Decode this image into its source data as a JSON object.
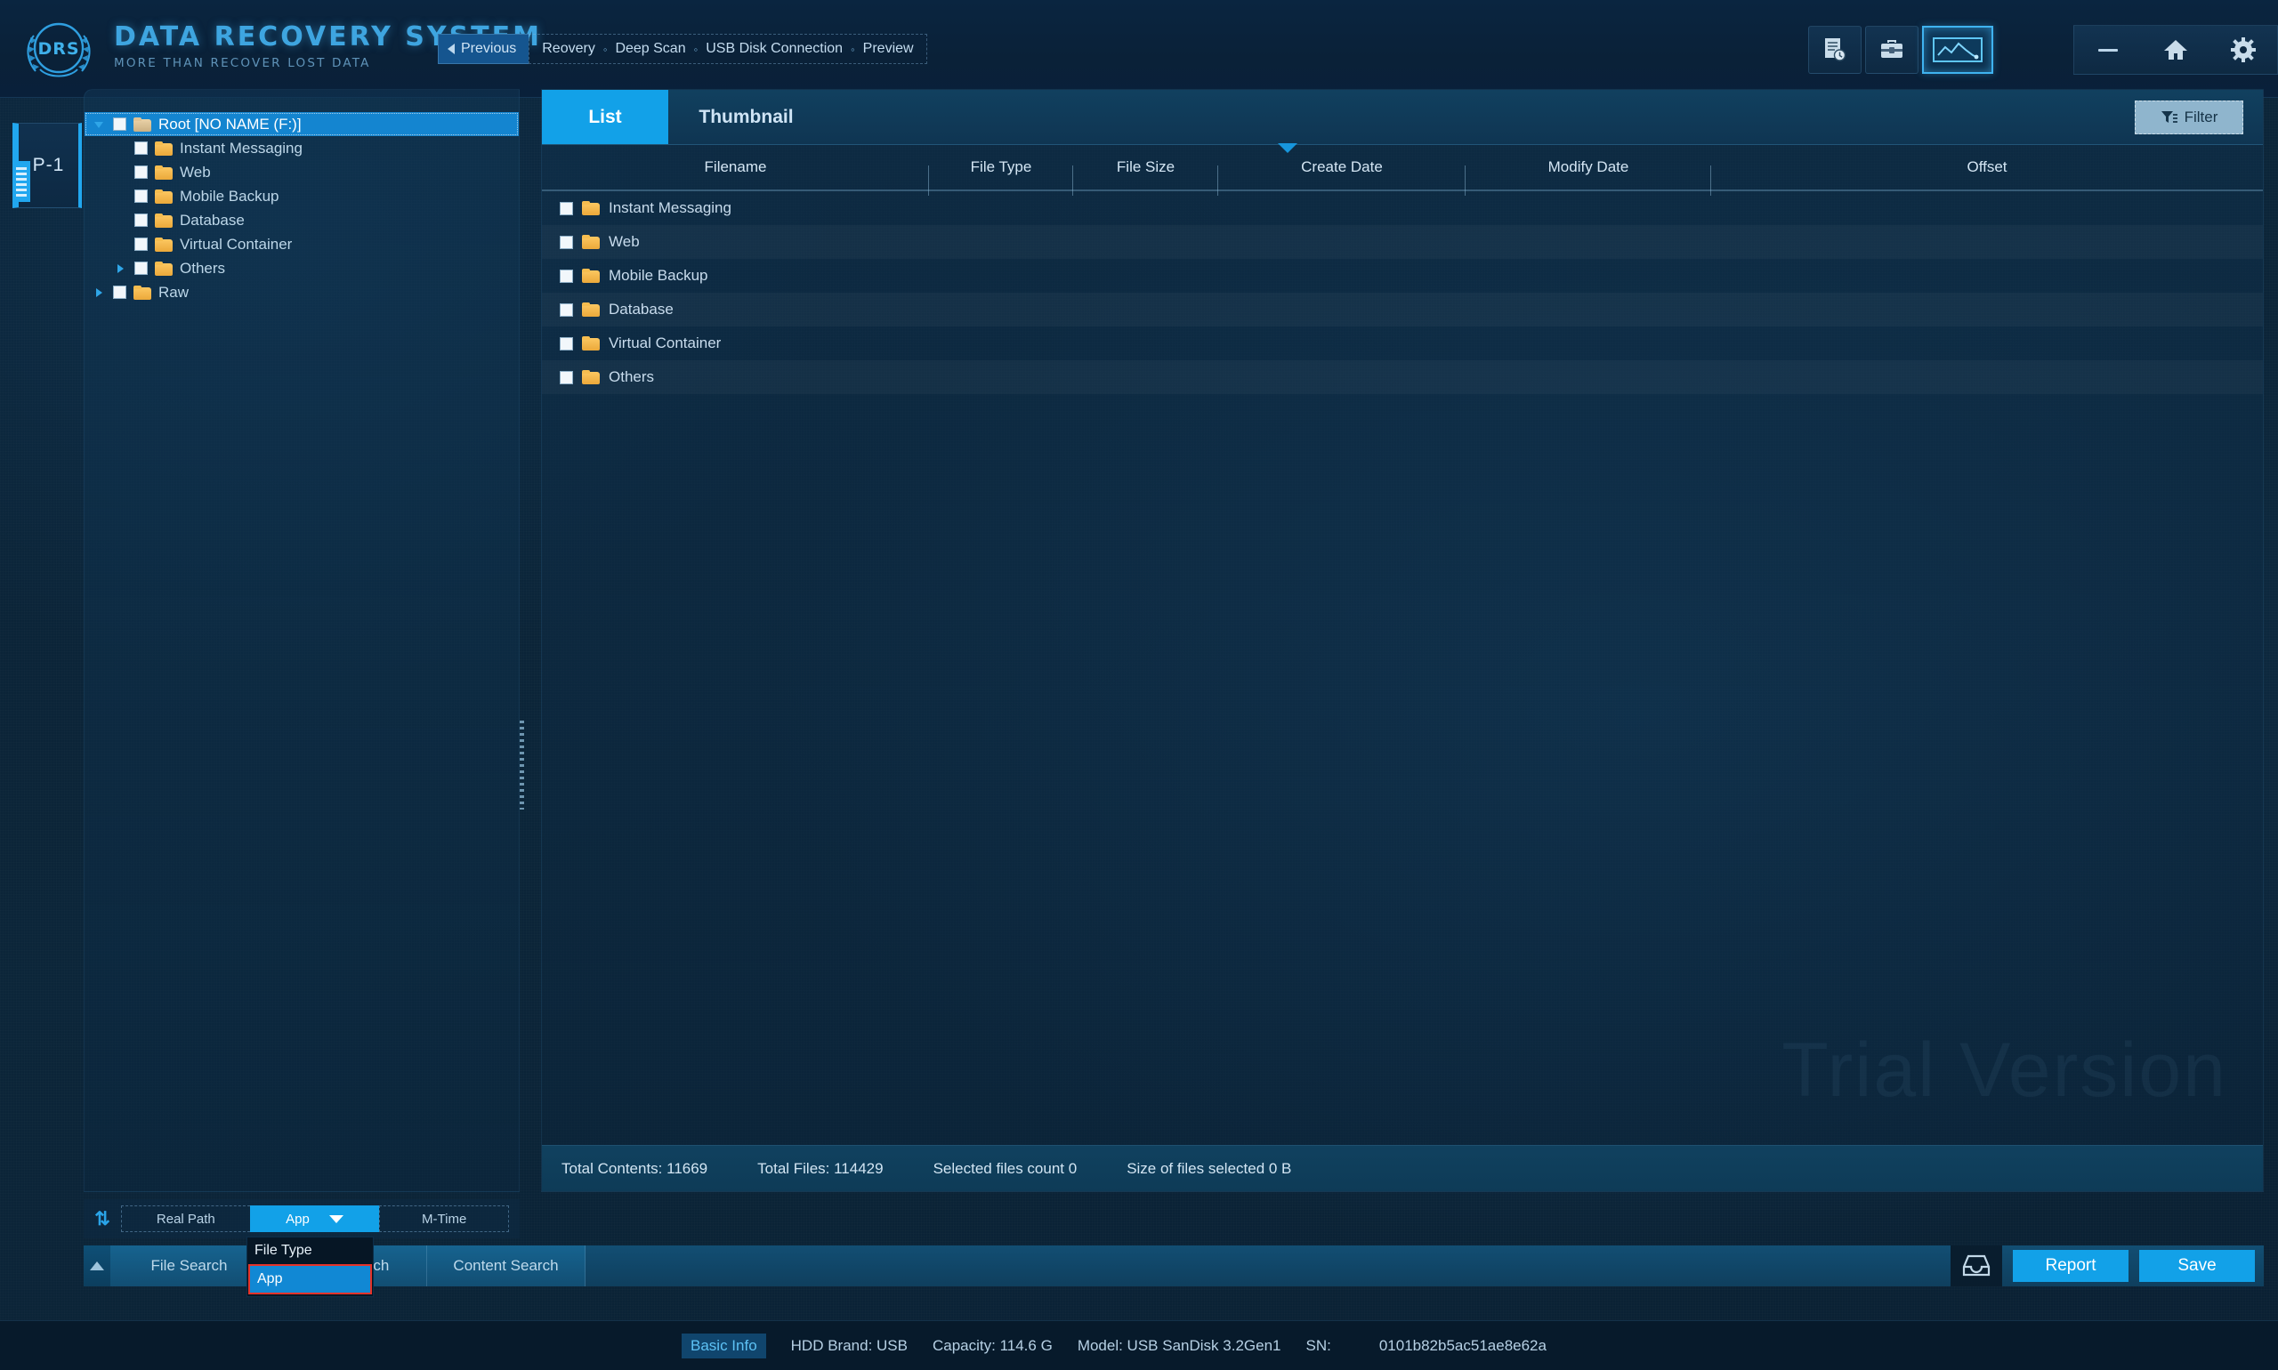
{
  "brand": {
    "title": "DATA RECOVERY SYSTEM",
    "subtitle": "MORE THAN RECOVER LOST DATA",
    "logo_text": "DRS"
  },
  "breadcrumb": {
    "previous_label": "Previous",
    "steps": [
      "Reovery",
      "Deep Scan",
      "USB Disk Connection",
      "Preview"
    ],
    "separator": "○"
  },
  "titlebar_icons": [
    {
      "name": "log-report-icon",
      "glyph": "Ὕ2"
    },
    {
      "name": "toolbox-icon",
      "glyph": "toolbox"
    },
    {
      "name": "disk-monitor-icon",
      "glyph": "chart",
      "active": true
    }
  ],
  "window_controls": [
    {
      "name": "minimize-button",
      "label": "—"
    },
    {
      "name": "home-button",
      "label": "home"
    },
    {
      "name": "settings-button",
      "label": "gear"
    }
  ],
  "partition_tab": {
    "label": "P-1"
  },
  "tree": {
    "nodes": [
      {
        "label": "Root [NO NAME    (F:)]",
        "indent": 0,
        "arrow": "down",
        "selected": true,
        "checked": false
      },
      {
        "label": "Instant Messaging",
        "indent": 1,
        "arrow": "none",
        "selected": false,
        "checked": false
      },
      {
        "label": "Web",
        "indent": 1,
        "arrow": "none",
        "selected": false,
        "checked": false
      },
      {
        "label": "Mobile Backup",
        "indent": 1,
        "arrow": "none",
        "selected": false,
        "checked": false
      },
      {
        "label": "Database",
        "indent": 1,
        "arrow": "none",
        "selected": false,
        "checked": false
      },
      {
        "label": "Virtual Container",
        "indent": 1,
        "arrow": "none",
        "selected": false,
        "checked": false
      },
      {
        "label": "Others",
        "indent": 1,
        "arrow": "right",
        "selected": false,
        "checked": false
      },
      {
        "label": "Raw",
        "indent": 0,
        "arrow": "right",
        "selected": false,
        "checked": false
      }
    ]
  },
  "main": {
    "tabs": [
      {
        "label": "List",
        "active": true
      },
      {
        "label": "Thumbnail",
        "active": false
      }
    ],
    "filter_label": "Filter",
    "columns": [
      "Filename",
      "File Type",
      "File Size",
      "Create Date",
      "Modify Date",
      "Offset"
    ],
    "rows": [
      {
        "filename": "Instant Messaging",
        "file_type": "",
        "file_size": "",
        "create_date": "",
        "modify_date": "",
        "offset": ""
      },
      {
        "filename": "Web",
        "file_type": "",
        "file_size": "",
        "create_date": "",
        "modify_date": "",
        "offset": ""
      },
      {
        "filename": "Mobile Backup",
        "file_type": "",
        "file_size": "",
        "create_date": "",
        "modify_date": "",
        "offset": ""
      },
      {
        "filename": "Database",
        "file_type": "",
        "file_size": "",
        "create_date": "",
        "modify_date": "",
        "offset": ""
      },
      {
        "filename": "Virtual Container",
        "file_type": "",
        "file_size": "",
        "create_date": "",
        "modify_date": "",
        "offset": ""
      },
      {
        "filename": "Others",
        "file_type": "",
        "file_size": "",
        "create_date": "",
        "modify_date": "",
        "offset": ""
      }
    ],
    "watermark": "Trial Version",
    "status": {
      "total_contents": "Total Contents: 11669",
      "total_files": "Total Files: 114429",
      "selected_count": "Selected files count 0",
      "selected_size": "Size of files  selected  0 B"
    }
  },
  "sortbar": {
    "sort_icon": "⇅",
    "segments": [
      {
        "label": "Real Path",
        "active": false
      },
      {
        "label": "App",
        "active": true
      },
      {
        "label": "M-Time",
        "active": false
      }
    ]
  },
  "dropdown": {
    "options": [
      {
        "label": "File Type",
        "selected": false
      },
      {
        "label": "App",
        "selected": true
      }
    ]
  },
  "searchbar": {
    "tabs": [
      "File Search",
      "Path Search",
      "Content Search"
    ],
    "inbox_icon": "inbox",
    "report_label": "Report",
    "save_label": "Save"
  },
  "infobar": {
    "basic_info": "Basic Info",
    "hdd_brand": "HDD Brand: USB",
    "capacity": "Capacity: 114.6 G",
    "model": "Model: USB SanDisk 3.2Gen1",
    "sn_label": "SN:",
    "sn_value": "0101b82b5ac51ae8e62a"
  },
  "colors": {
    "accent": "#12a1e8",
    "accent_dark": "#15558f",
    "folder": "#f6bd4f",
    "bg": "#0b2236",
    "select_red": "#e5332a"
  }
}
